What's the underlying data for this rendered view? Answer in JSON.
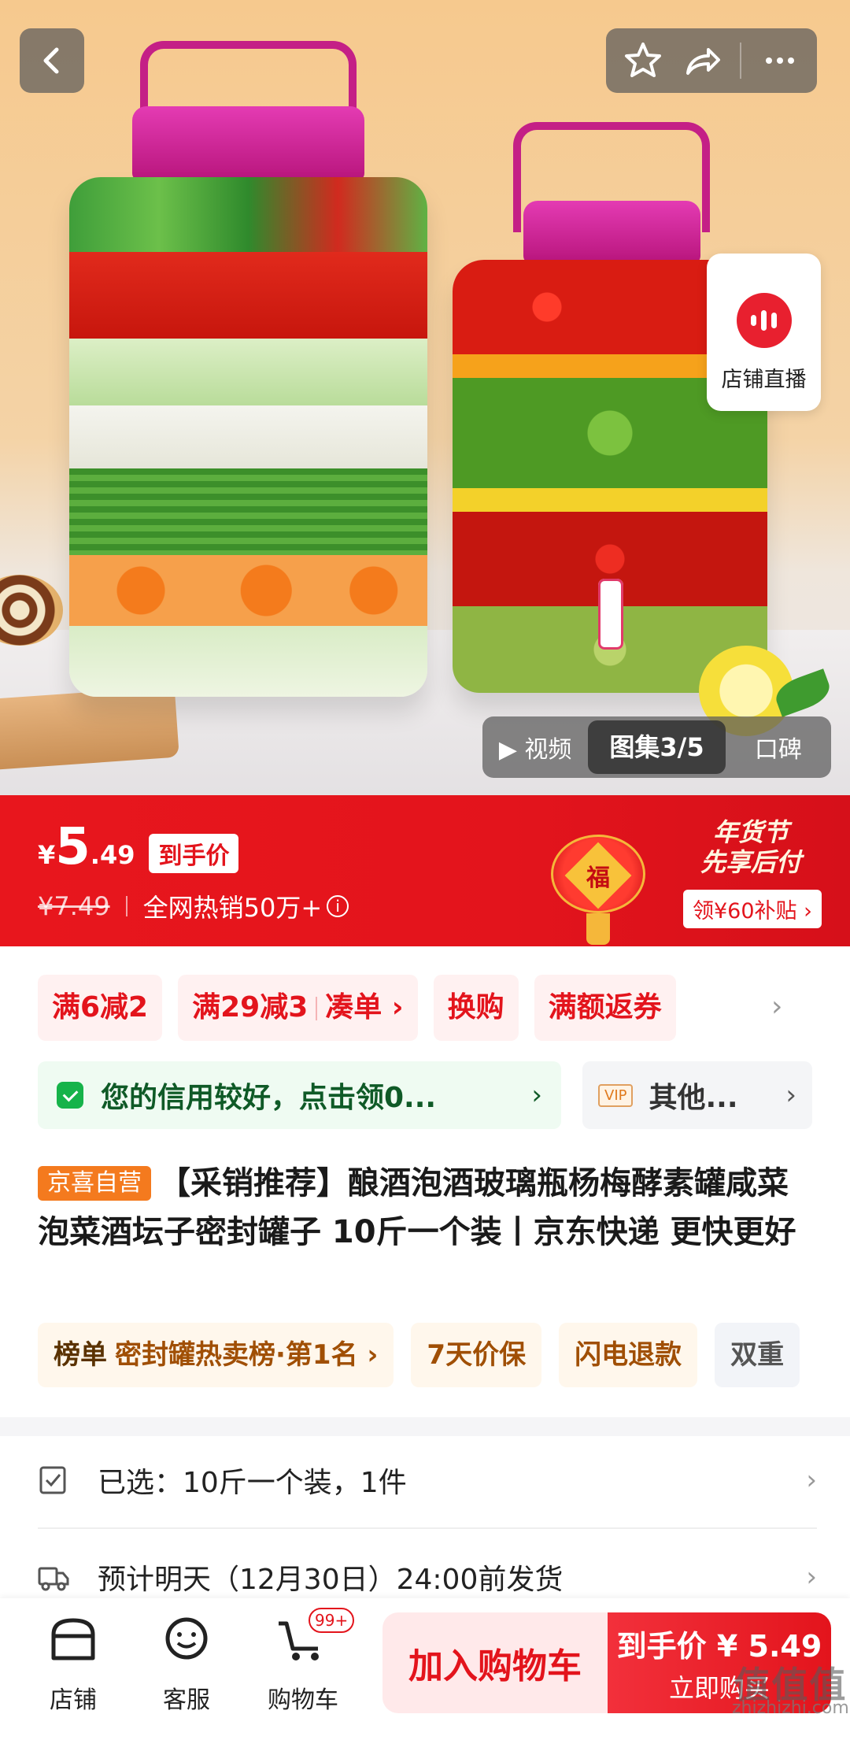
{
  "hero": {
    "live_label": "店铺直播",
    "media_tabs": [
      "视频",
      "图集3/5",
      "口碑"
    ]
  },
  "price": {
    "currency": "¥",
    "integer": "5",
    "decimal": ".49",
    "tag": "到手价",
    "original": "¥7.49",
    "sales": "全网热销50万+",
    "info_icon": "i",
    "lantern_char": "福",
    "promo_title_1": "年货节",
    "promo_title_2": "先享后付",
    "promo_button": "领¥60补贴 ›"
  },
  "coupons": {
    "items": [
      "满6减2",
      "满29减3",
      "凑单 ›",
      "换购",
      "满额返券"
    ],
    "more": "›"
  },
  "credit": {
    "text": "您的信用较好，点击领0...",
    "arrow": "›"
  },
  "vip": {
    "badge": "VIP",
    "text": "其他...",
    "arrow": "›"
  },
  "product": {
    "badge": "京喜自营",
    "title": "【采销推荐】酿酒泡酒玻璃瓶杨梅酵素罐咸菜泡菜酒坛子密封罐子 10斤一个装丨京东快递 更快更好"
  },
  "tags": {
    "rank_key": "榜单",
    "rank_value": "密封罐热卖榜·第1名 ›",
    "t1": "7天价保",
    "t2": "闪电退款",
    "t3": "双重"
  },
  "selected": {
    "text": "已选：10斤一个装，1件",
    "arrow": "›"
  },
  "delivery": {
    "text": "预计明天（12月30日）24:00前发货",
    "arrow": "›"
  },
  "bottom": {
    "store": "店铺",
    "service": "客服",
    "cart": "购物车",
    "cart_badge": "99+",
    "add_cart": "加入购物车",
    "buy_top": "到手价 ¥ 5.49",
    "buy_bottom": "立即购买"
  },
  "watermark": {
    "big": "值值值",
    "small": "zhizhizhi.com"
  },
  "colors": {
    "brand_red": "#e3141c",
    "green": "#16b34a",
    "orange": "#f47a1e"
  }
}
